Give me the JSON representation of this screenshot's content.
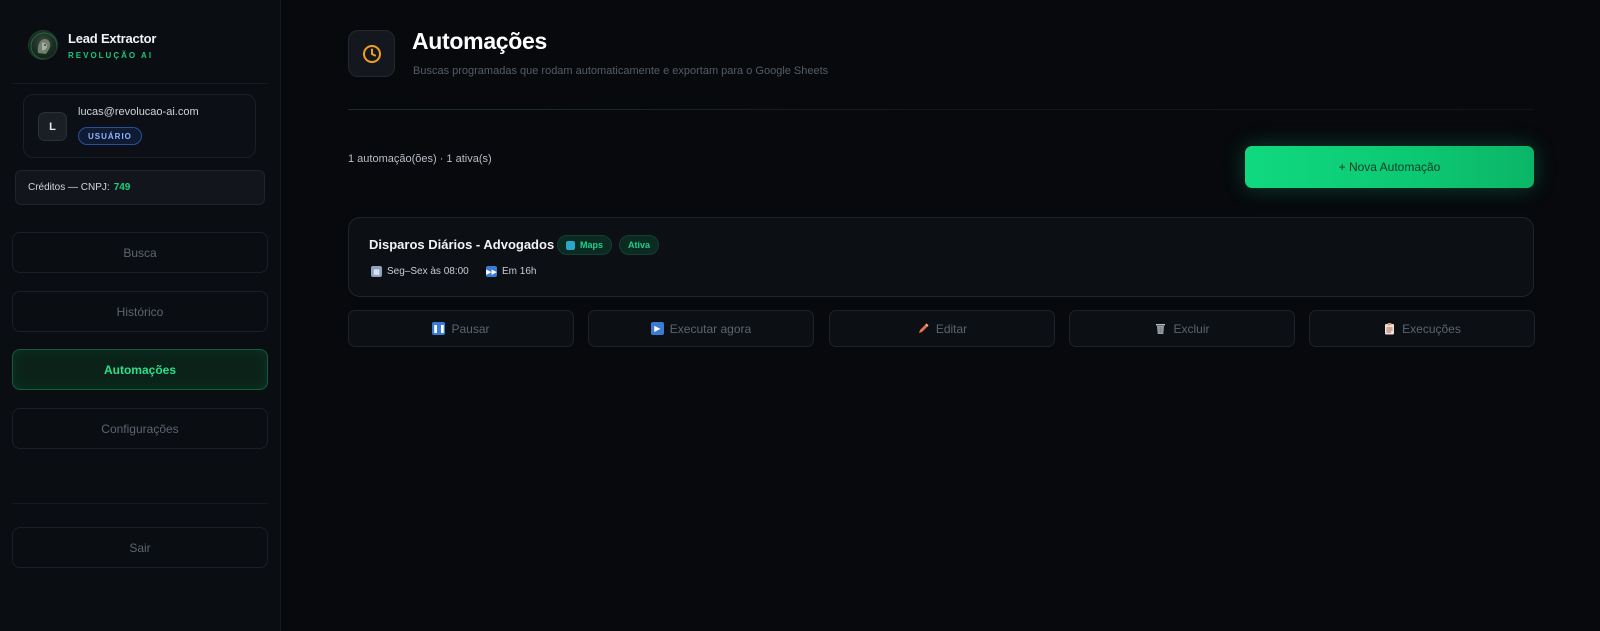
{
  "sidebar": {
    "brand": {
      "title": "Lead Extractor",
      "subtitle": "REVOLUÇÃO AI",
      "logo_icon": "lion-logo"
    },
    "user": {
      "avatar_initial": "L",
      "email": "lucas@revolucao-ai.com",
      "role_badge": "USUÁRIO"
    },
    "credits": {
      "label": "Créditos — CNPJ:",
      "value": "749"
    },
    "nav": [
      {
        "label": "Busca",
        "active": false
      },
      {
        "label": "Histórico",
        "active": false
      },
      {
        "label": "Automações",
        "active": true
      },
      {
        "label": "Configurações",
        "active": false
      }
    ],
    "logout_label": "Sair"
  },
  "header": {
    "icon": "clock-icon",
    "title": "Automações",
    "subtitle": "Buscas programadas que rodam automaticamente e exportam para o Google Sheets"
  },
  "toolbar": {
    "summary": "1 automação(ões) · 1 ativa(s)",
    "new_button": "+ Nova Automação"
  },
  "automations": [
    {
      "name": "Disparos Diários - Advogados",
      "source_tag": "Maps",
      "status": "Ativa",
      "schedule": "Seg–Sex às 08:00",
      "next_run": "Em 16h"
    }
  ],
  "actions": [
    {
      "label": "Pausar",
      "icon": "pause-icon"
    },
    {
      "label": "Executar agora",
      "icon": "play-icon"
    },
    {
      "label": "Editar",
      "icon": "pencil-icon"
    },
    {
      "label": "Excluir",
      "icon": "trash-icon"
    },
    {
      "label": "Execuções",
      "icon": "clipboard-icon"
    }
  ],
  "colors": {
    "background": "#07090d",
    "accent": "#10d97f",
    "badge_blue": "#8fb4ff",
    "clock_orange": "#f0a020"
  }
}
